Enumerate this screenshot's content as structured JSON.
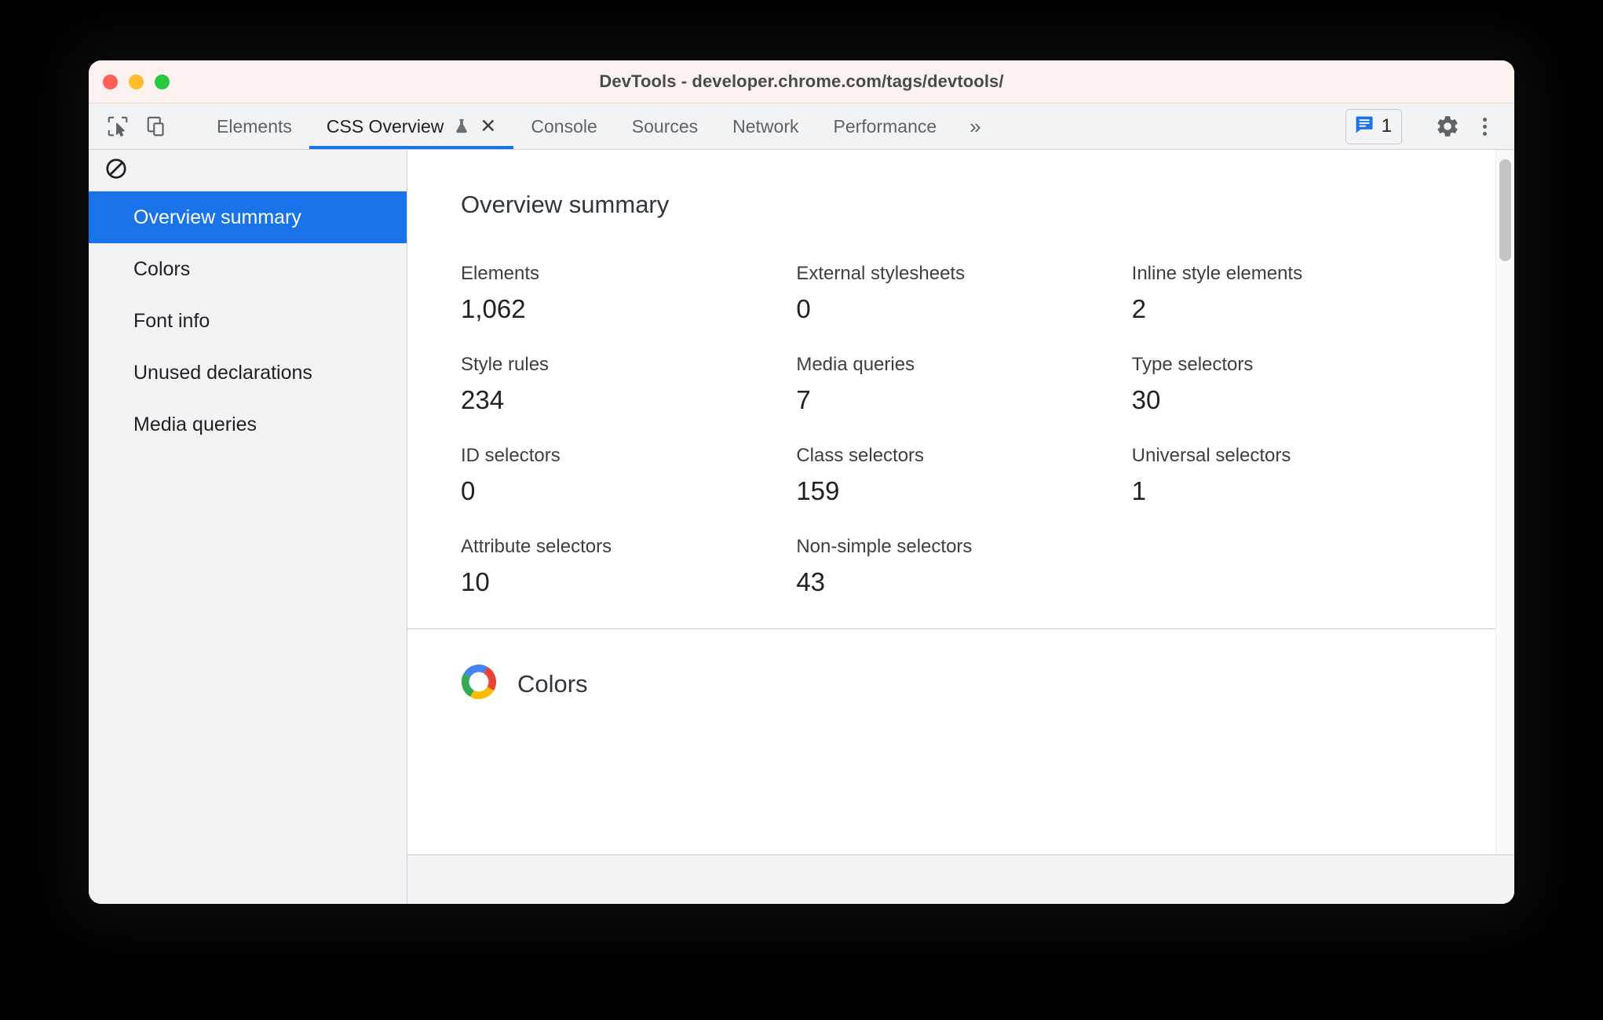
{
  "window": {
    "title": "DevTools - developer.chrome.com/tags/devtools/",
    "traffic_lights": [
      "close",
      "minimize",
      "zoom"
    ],
    "colors": {
      "titlebar_bg": "#fbf2f0",
      "accent": "#1a73e8",
      "toolbar_bg": "#f1f3f4",
      "panel_bg": "#ffffff"
    }
  },
  "toolbar": {
    "inspect_icon": "inspect-cursor-icon",
    "device_icon": "device-toolbar-icon",
    "tabs": [
      {
        "label": "Elements",
        "active": false
      },
      {
        "label": "CSS Overview",
        "active": true,
        "experimental": true,
        "closable": true
      },
      {
        "label": "Console",
        "active": false
      },
      {
        "label": "Sources",
        "active": false
      },
      {
        "label": "Network",
        "active": false
      },
      {
        "label": "Performance",
        "active": false
      }
    ],
    "overflow_label": "»",
    "issues": {
      "icon": "issues-message-icon",
      "count": "1"
    },
    "settings_icon": "gear-icon",
    "more_icon": "kebab-menu-icon",
    "close_tab_label": "✕"
  },
  "sidebar": {
    "clear_icon": "block-clear-icon",
    "items": [
      {
        "label": "Overview summary",
        "selected": true
      },
      {
        "label": "Colors",
        "selected": false
      },
      {
        "label": "Font info",
        "selected": false
      },
      {
        "label": "Unused declarations",
        "selected": false
      },
      {
        "label": "Media queries",
        "selected": false
      }
    ]
  },
  "main": {
    "summary": {
      "title": "Overview summary",
      "stats": [
        {
          "label": "Elements",
          "value": "1,062"
        },
        {
          "label": "External stylesheets",
          "value": "0"
        },
        {
          "label": "Inline style elements",
          "value": "2"
        },
        {
          "label": "Style rules",
          "value": "234"
        },
        {
          "label": "Media queries",
          "value": "7"
        },
        {
          "label": "Type selectors",
          "value": "30"
        },
        {
          "label": "ID selectors",
          "value": "0"
        },
        {
          "label": "Class selectors",
          "value": "159"
        },
        {
          "label": "Universal selectors",
          "value": "1"
        },
        {
          "label": "Attribute selectors",
          "value": "10"
        },
        {
          "label": "Non-simple selectors",
          "value": "43"
        }
      ]
    },
    "colors_section": {
      "title": "Colors",
      "icon": "color-wheel-icon"
    }
  }
}
